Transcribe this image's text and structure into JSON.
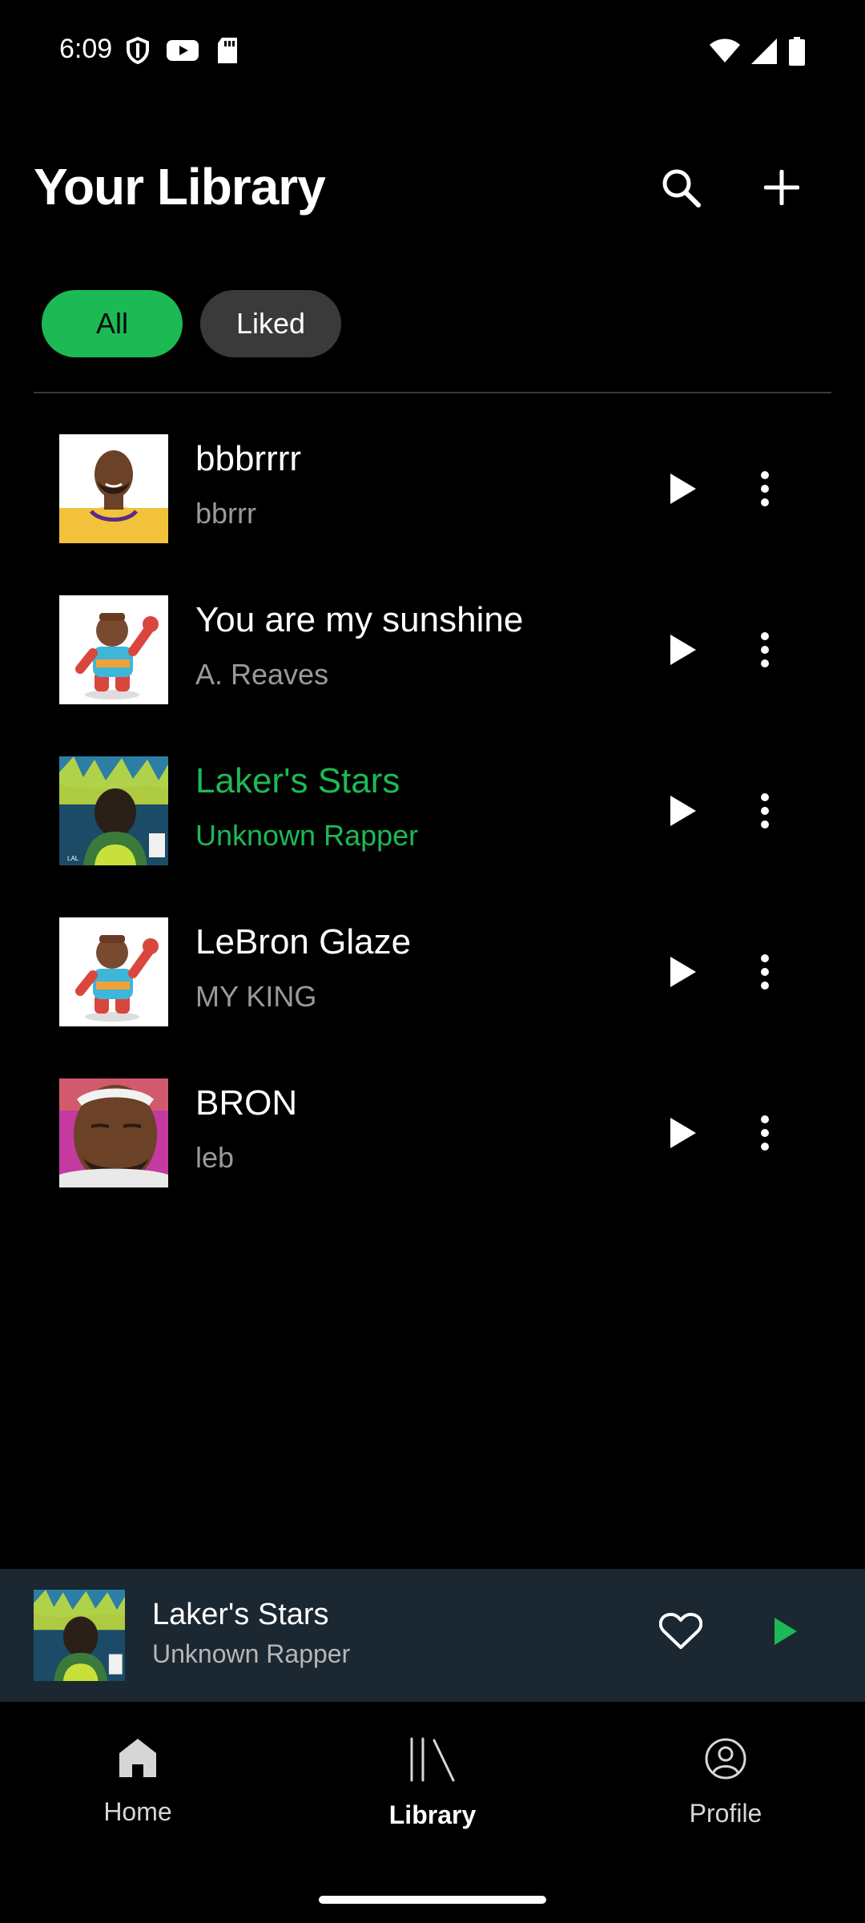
{
  "status_bar": {
    "time": "6:09",
    "icons_left": [
      "shield-icon",
      "youtube-icon",
      "sd-card-icon"
    ],
    "icons_right": [
      "wifi-icon",
      "cell-signal-icon",
      "battery-icon"
    ]
  },
  "header": {
    "title": "Your Library",
    "actions": [
      "search-icon",
      "add-icon"
    ]
  },
  "filters": {
    "items": [
      {
        "label": "All",
        "selected": true
      },
      {
        "label": "Liked",
        "selected": false
      }
    ]
  },
  "tracks": [
    {
      "title": "bbbrrrr",
      "artist": "bbrrr",
      "art": "lebron-photo",
      "active": false
    },
    {
      "title": "You are my sunshine",
      "artist": "A. Reaves",
      "art": "toy-figure",
      "active": false
    },
    {
      "title": "Laker's Stars",
      "artist": "Unknown Rapper",
      "art": "album-cover",
      "active": true
    },
    {
      "title": "LeBron Glaze",
      "artist": "MY KING",
      "art": "toy-figure",
      "active": false
    },
    {
      "title": "BRON",
      "artist": "leb",
      "art": "closeup-face",
      "active": false
    }
  ],
  "mini_player": {
    "title": "Laker's Stars",
    "artist": "Unknown Rapper",
    "actions": [
      "heart-icon",
      "play-icon"
    ]
  },
  "bottom_nav": {
    "items": [
      {
        "label": "Home",
        "icon": "home-icon",
        "active": false
      },
      {
        "label": "Library",
        "icon": "library-icon",
        "active": true
      },
      {
        "label": "Profile",
        "icon": "profile-icon",
        "active": false
      }
    ]
  },
  "colors": {
    "accent": "#1db954",
    "background": "#000000",
    "chip_inactive": "#3a3a3a",
    "mini_player_bg": "#1b2731",
    "muted_text": "#9a9a9a"
  }
}
